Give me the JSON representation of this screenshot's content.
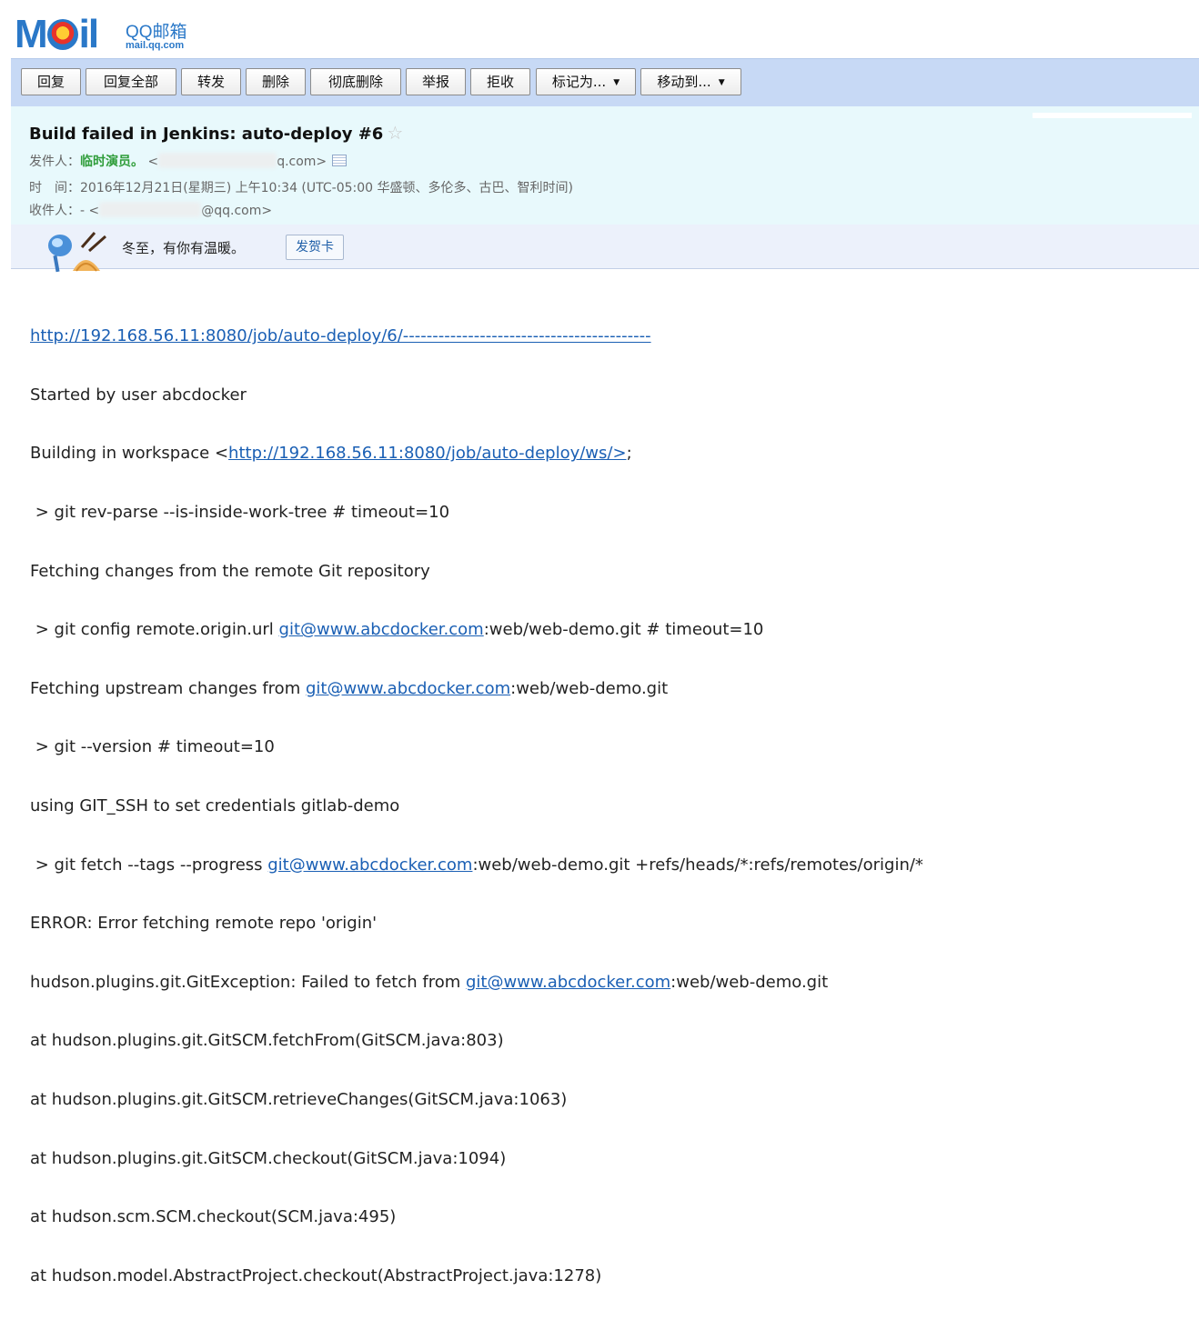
{
  "logo": {
    "brand": "QQ邮箱",
    "domain": "mail.qq.com"
  },
  "toolbar": {
    "buttons": [
      "回复",
      "回复全部",
      "转发",
      "删除",
      "彻底删除",
      "举报",
      "拒收",
      "标记为...",
      "移动到..."
    ]
  },
  "email": {
    "subject": "Build failed in Jenkins: auto-deploy #6",
    "sender_label": "发件人：",
    "sender_name": "临时演员。",
    "sender_email_open": "<",
    "sender_email_tail": "q.com>",
    "time_label": "时　间：",
    "time_value": "2016年12月21日(星期三) 上午10:34 (UTC-05:00 华盛顿、多伦多、古巴、智利时间)",
    "recipient_label": "收件人：- <",
    "recipient_email_tail": "@qq.com>"
  },
  "greeting": {
    "text": "冬至，有你有温暖。",
    "button": "发贺卡"
  },
  "body": {
    "link1": "http://192.168.56.11:8080/job/auto-deploy/6/------------------------------------------",
    "l2": "Started by user abcdocker",
    "l3_pre": "Building in workspace <",
    "l3_link": "http://192.168.56.11:8080/job/auto-deploy/ws/>",
    "l3_post": ";",
    "l4": " > git rev-parse --is-inside-work-tree # timeout=10",
    "l5": "Fetching changes from the remote Git repository",
    "l6_pre": " > git config remote.origin.url ",
    "git_link": "git@www.abcdocker.com",
    "l6_post": ":web/web-demo.git # timeout=10",
    "l7_pre": "Fetching upstream changes from ",
    "l7_post": ":web/web-demo.git",
    "l8": " > git --version # timeout=10",
    "l9": "using GIT_SSH to set credentials gitlab-demo",
    "l10_pre": " > git fetch --tags --progress ",
    "l10_post": ":web/web-demo.git +refs/heads/*:refs/remotes/origin/*",
    "l11": "ERROR: Error fetching remote repo 'origin'",
    "l12_pre": "hudson.plugins.git.GitException: Failed to fetch from ",
    "l12_post": ":web/web-demo.git",
    "l13": "at hudson.plugins.git.GitSCM.fetchFrom(GitSCM.java:803)",
    "l14": "at hudson.plugins.git.GitSCM.retrieveChanges(GitSCM.java:1063)",
    "l15": "at hudson.plugins.git.GitSCM.checkout(GitSCM.java:1094)",
    "l16": "at hudson.scm.SCM.checkout(SCM.java:495)",
    "l17": "at hudson.model.AbstractProject.checkout(AbstractProject.java:1278)"
  }
}
